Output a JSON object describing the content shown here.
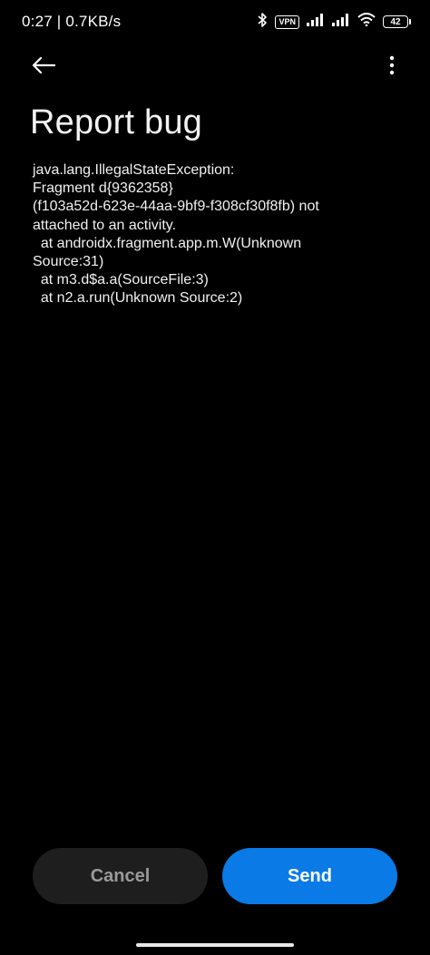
{
  "status_bar": {
    "time_speed": "0:27 | 0.7KB/s",
    "vpn": "VPN",
    "battery": "42"
  },
  "icons": {
    "back": "arrow-left-icon",
    "more": "more-vertical-icon",
    "bluetooth": "bluetooth-icon",
    "signal": "signal-icon",
    "wifi": "wifi-icon"
  },
  "page": {
    "title": "Report bug",
    "trace": "java.lang.IllegalStateException:\nFragment d{9362358}\n(f103a52d-623e-44aa-9bf9-f308cf30f8fb) not\nattached to an activity.\n  at androidx.fragment.app.m.W(Unknown\nSource:31)\n  at m3.d$a.a(SourceFile:3)\n  at n2.a.run(Unknown Source:2)"
  },
  "actions": {
    "cancel_label": "Cancel",
    "send_label": "Send"
  },
  "colors": {
    "background": "#000000",
    "send_button": "#0a7ae6",
    "cancel_button": "#1e1e1e"
  }
}
